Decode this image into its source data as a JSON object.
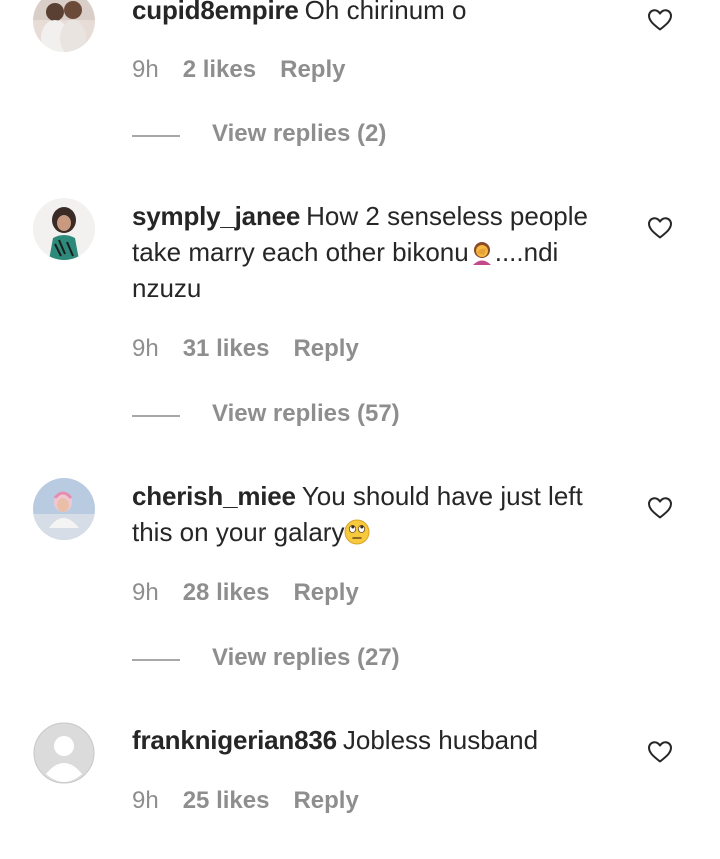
{
  "comments": [
    {
      "username": "cupid8empire",
      "text": "Oh chirinum o",
      "emoji": "",
      "text_after": "",
      "time": "9h",
      "likes": "2 likes",
      "reply": "Reply",
      "view_replies": "View replies (2)"
    },
    {
      "username": "symply_janee",
      "text": "How 2 senseless people take marry each other bikonu",
      "emoji": "woman-facepalming",
      "text_after": "....ndi nzuzu",
      "time": "9h",
      "likes": "31 likes",
      "reply": "Reply",
      "view_replies": "View replies (57)"
    },
    {
      "username": "cherish_miee",
      "text": "You should have just left this on your galary",
      "emoji": "face-with-rolling-eyes",
      "text_after": "",
      "time": "9h",
      "likes": "28 likes",
      "reply": "Reply",
      "view_replies": "View replies (27)"
    },
    {
      "username": "franknigerian836",
      "text": "Jobless husband",
      "emoji": "",
      "text_after": "",
      "time": "9h",
      "likes": "25 likes",
      "reply": "Reply",
      "view_replies": ""
    }
  ],
  "icons": {
    "like": "heart-outline-icon",
    "avatar_default": "default-avatar-icon"
  },
  "colors": {
    "text": "#262626",
    "secondary": "#8e8e8e",
    "divider": "#a8a8a8"
  }
}
